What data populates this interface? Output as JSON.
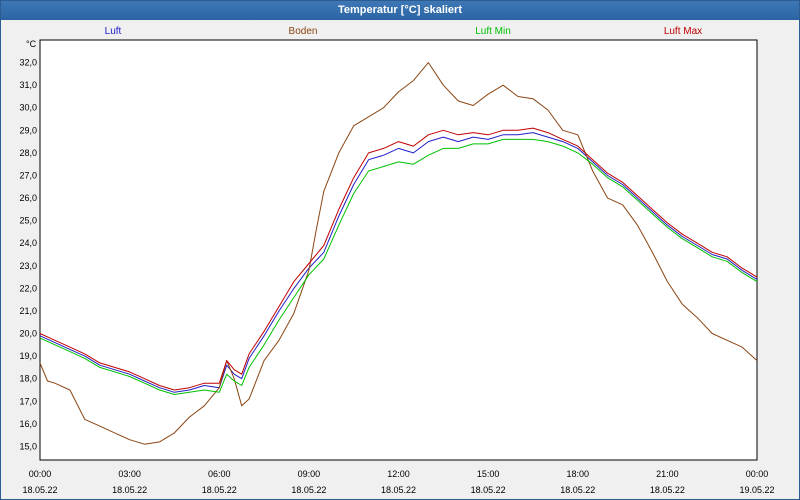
{
  "window": {
    "title": "Temperatur [°C] skaliert"
  },
  "chart_data": {
    "type": "line",
    "title": "Temperatur [°C] skaliert",
    "y_unit": "°C",
    "xlim": [
      0,
      24
    ],
    "ylim": [
      14.4,
      33.0
    ],
    "grid": true,
    "legend_position": "top",
    "x_ticks": [
      {
        "x": 0,
        "time": "00:00",
        "date": "18.05.22"
      },
      {
        "x": 3,
        "time": "03:00",
        "date": "18.05.22"
      },
      {
        "x": 6,
        "time": "06:00",
        "date": "18.05.22"
      },
      {
        "x": 9,
        "time": "09:00",
        "date": "18.05.22"
      },
      {
        "x": 12,
        "time": "12:00",
        "date": "18.05.22"
      },
      {
        "x": 15,
        "time": "15:00",
        "date": "18.05.22"
      },
      {
        "x": 18,
        "time": "18:00",
        "date": "18.05.22"
      },
      {
        "x": 21,
        "time": "21:00",
        "date": "18.05.22"
      },
      {
        "x": 24,
        "time": "00:00",
        "date": "19.05.22"
      }
    ],
    "y_ticks": [
      "15,0",
      "16,0",
      "17,0",
      "18,0",
      "19,0",
      "20,0",
      "21,0",
      "22,0",
      "23,0",
      "24,0",
      "25,0",
      "26,0",
      "27,0",
      "28,0",
      "29,0",
      "30,0",
      "31,0",
      "32,0"
    ],
    "series": [
      {
        "name": "Luft",
        "color": "#2020c8",
        "x": [
          0,
          0.5,
          1,
          1.5,
          2,
          2.5,
          3,
          3.5,
          4,
          4.5,
          5,
          5.5,
          6,
          6.25,
          6.5,
          6.75,
          7,
          7.5,
          8,
          8.5,
          9,
          9.5,
          10,
          10.5,
          11,
          11.5,
          12,
          12.5,
          13,
          13.5,
          14,
          14.5,
          15,
          15.5,
          16,
          16.5,
          17,
          17.5,
          18,
          18.5,
          19,
          19.5,
          20,
          20.5,
          21,
          21.5,
          22,
          22.5,
          23,
          23.5,
          24
        ],
        "y": [
          19.9,
          19.6,
          19.3,
          19.0,
          18.6,
          18.4,
          18.2,
          17.9,
          17.6,
          17.4,
          17.5,
          17.7,
          17.6,
          18.6,
          18.2,
          18.0,
          18.9,
          19.9,
          21.0,
          22.0,
          22.9,
          23.6,
          25.2,
          26.6,
          27.7,
          27.9,
          28.2,
          28.0,
          28.5,
          28.7,
          28.5,
          28.7,
          28.6,
          28.8,
          28.8,
          28.9,
          28.7,
          28.5,
          28.2,
          27.6,
          27.0,
          26.6,
          26.0,
          25.4,
          24.8,
          24.3,
          23.9,
          23.5,
          23.3,
          22.8,
          22.4
        ]
      },
      {
        "name": "Boden",
        "color": "#8b4513",
        "x": [
          0,
          0.25,
          0.5,
          1,
          1.5,
          2,
          2.5,
          3,
          3.5,
          4,
          4.5,
          5,
          5.5,
          6,
          6.25,
          6.5,
          6.75,
          7,
          7.5,
          8,
          8.5,
          9,
          9.25,
          9.5,
          10,
          10.5,
          11,
          11.5,
          12,
          12.5,
          13,
          13.5,
          14,
          14.5,
          15,
          15.5,
          16,
          16.5,
          17,
          17.5,
          18,
          18.5,
          19,
          19.5,
          20,
          20.5,
          21,
          21.5,
          22,
          22.5,
          23,
          23.5,
          24
        ],
        "y": [
          18.7,
          17.9,
          17.8,
          17.5,
          16.2,
          15.9,
          15.6,
          15.3,
          15.1,
          15.2,
          15.6,
          16.3,
          16.8,
          17.6,
          18.8,
          18.0,
          16.8,
          17.1,
          18.8,
          19.7,
          20.9,
          22.8,
          24.6,
          26.3,
          28.0,
          29.2,
          29.6,
          30.0,
          30.7,
          31.2,
          32.0,
          31.0,
          30.3,
          30.1,
          30.6,
          31.0,
          30.5,
          30.4,
          29.9,
          29.0,
          28.8,
          27.2,
          26.0,
          25.7,
          24.8,
          23.6,
          22.3,
          21.3,
          20.7,
          20.0,
          19.7,
          19.4,
          18.8
        ]
      },
      {
        "name": "Luft Min",
        "color": "#00c000",
        "x": [
          0,
          0.5,
          1,
          1.5,
          2,
          2.5,
          3,
          3.5,
          4,
          4.5,
          5,
          5.5,
          6,
          6.25,
          6.5,
          6.75,
          7,
          7.5,
          8,
          8.5,
          9,
          9.5,
          10,
          10.5,
          11,
          11.5,
          12,
          12.5,
          13,
          13.5,
          14,
          14.5,
          15,
          15.5,
          16,
          16.5,
          17,
          17.5,
          18,
          18.5,
          19,
          19.5,
          20,
          20.5,
          21,
          21.5,
          22,
          22.5,
          23,
          23.5,
          24
        ],
        "y": [
          19.8,
          19.5,
          19.2,
          18.9,
          18.5,
          18.3,
          18.1,
          17.8,
          17.5,
          17.3,
          17.4,
          17.5,
          17.4,
          18.2,
          17.9,
          17.7,
          18.5,
          19.5,
          20.6,
          21.6,
          22.6,
          23.3,
          24.8,
          26.2,
          27.2,
          27.4,
          27.6,
          27.5,
          27.9,
          28.2,
          28.2,
          28.4,
          28.4,
          28.6,
          28.6,
          28.6,
          28.5,
          28.3,
          28.0,
          27.5,
          26.9,
          26.5,
          25.9,
          25.3,
          24.7,
          24.2,
          23.8,
          23.4,
          23.2,
          22.7,
          22.3
        ]
      },
      {
        "name": "Luft Max",
        "color": "#c00000",
        "x": [
          0,
          0.5,
          1,
          1.5,
          2,
          2.5,
          3,
          3.5,
          4,
          4.5,
          5,
          5.5,
          6,
          6.25,
          6.5,
          6.75,
          7,
          7.5,
          8,
          8.5,
          9,
          9.5,
          10,
          10.5,
          11,
          11.5,
          12,
          12.5,
          13,
          13.5,
          14,
          14.5,
          15,
          15.5,
          16,
          16.5,
          17,
          17.5,
          18,
          18.5,
          19,
          19.5,
          20,
          20.5,
          21,
          21.5,
          22,
          22.5,
          23,
          23.5,
          24
        ],
        "y": [
          20.0,
          19.7,
          19.4,
          19.1,
          18.7,
          18.5,
          18.3,
          18.0,
          17.7,
          17.5,
          17.6,
          17.8,
          17.8,
          18.8,
          18.4,
          18.2,
          19.1,
          20.1,
          21.2,
          22.3,
          23.1,
          23.9,
          25.5,
          26.9,
          28.0,
          28.2,
          28.5,
          28.3,
          28.8,
          29.0,
          28.8,
          28.9,
          28.8,
          29.0,
          29.0,
          29.1,
          28.9,
          28.6,
          28.3,
          27.7,
          27.1,
          26.7,
          26.1,
          25.5,
          24.9,
          24.4,
          24.0,
          23.6,
          23.4,
          22.9,
          22.5
        ]
      }
    ]
  }
}
